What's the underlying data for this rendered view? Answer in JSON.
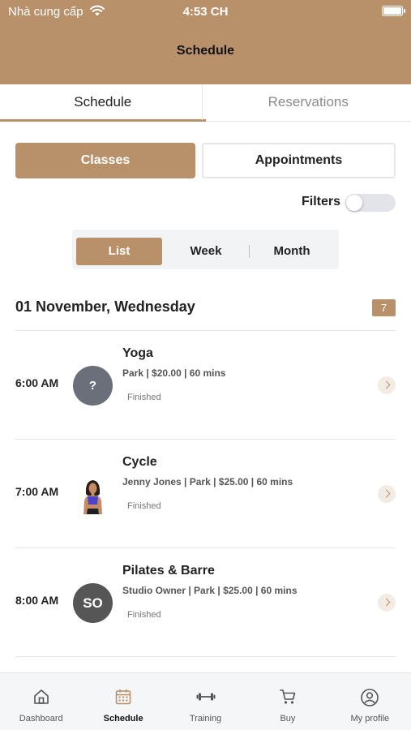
{
  "status_bar": {
    "carrier": "Nhà cung cấp",
    "time": "4:53 CH"
  },
  "header": {
    "title": "Schedule"
  },
  "top_tabs": [
    {
      "label": "Schedule",
      "active": true
    },
    {
      "label": "Reservations",
      "active": false
    }
  ],
  "segments": {
    "classes": "Classes",
    "appointments": "Appointments",
    "selected": "Classes"
  },
  "filters": {
    "label": "Filters",
    "enabled": false
  },
  "view_switch": {
    "list": "List",
    "week": "Week",
    "month": "Month",
    "selected": "List"
  },
  "day": {
    "heading": "01 November, Wednesday",
    "count": "7",
    "classes": [
      {
        "time": "6:00 AM",
        "title": "Yoga",
        "meta": "Park | $20.00 | 60 mins",
        "status": "Finished",
        "avatar": "?"
      },
      {
        "time": "7:00 AM",
        "title": "Cycle",
        "meta": "Jenny Jones | Park | $25.00 | 60 mins",
        "status": "Finished",
        "avatar": "photo"
      },
      {
        "time": "8:00 AM",
        "title": "Pilates & Barre",
        "meta": "Studio Owner | Park | $25.00 | 60 mins",
        "status": "Finished",
        "avatar": "SO"
      }
    ]
  },
  "tab_bar": {
    "items": [
      {
        "label": "Dashboard",
        "icon": "home-icon"
      },
      {
        "label": "Schedule",
        "icon": "calendar-icon",
        "active": true
      },
      {
        "label": "Training",
        "icon": "dumbbell-icon"
      },
      {
        "label": "Buy",
        "icon": "cart-icon"
      },
      {
        "label": "My profile",
        "icon": "profile-icon"
      }
    ]
  },
  "colors": {
    "accent": "#b8916a",
    "toggle_off": "#e2e4ea",
    "tab_bar_bg": "#f4f6f8"
  }
}
